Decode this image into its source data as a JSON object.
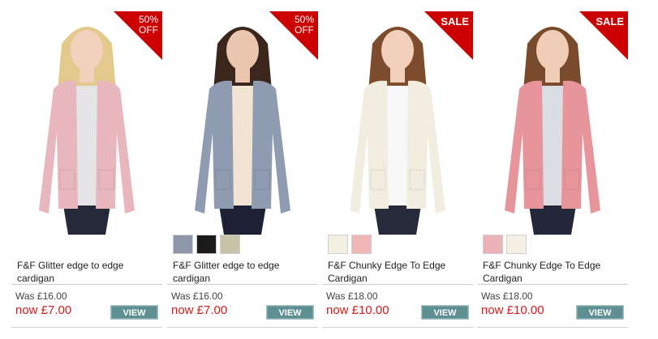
{
  "products": [
    {
      "badge": "50%\nOFF",
      "badge_type": "discount",
      "title_line1": "F&F Glitter edge to edge",
      "title_line2": "cardigan",
      "was": "Was £16.00",
      "now": "now £7.00",
      "view_label": "VIEW",
      "swatches": [],
      "colors": {
        "cardigan": "#e8b6bd",
        "top": "#e5e5e8",
        "jeans": "#26293a",
        "hair": "#e3c98b",
        "skin": "#f2d2bd"
      }
    },
    {
      "badge": "50%\nOFF",
      "badge_type": "discount",
      "title_line1": "F&F Glitter edge to edge",
      "title_line2": "cardigan",
      "was": "Was £16.00",
      "now": "now £7.00",
      "view_label": "VIEW",
      "swatches": [
        "#8d97a8",
        "#1c1b1b",
        "#c7c2a8"
      ],
      "colors": {
        "cardigan": "#8e9bb0",
        "top": "#f1e4d2",
        "jeans": "#1d2133",
        "hair": "#3a261c",
        "skin": "#eac6ae"
      }
    },
    {
      "badge": "SALE",
      "badge_type": "sale",
      "title_line1": "F&F Chunky Edge To Edge",
      "title_line2": "Cardigan",
      "was": "Was £18.00",
      "now": "now £10.00",
      "view_label": "VIEW",
      "swatches": [
        "#f3efe1",
        "#f0b7b9"
      ],
      "colors": {
        "cardigan": "#f1ede0",
        "top": "#f8f8f8",
        "jeans": "#262a3b",
        "hair": "#7c4c2c",
        "skin": "#f2cfba"
      }
    },
    {
      "badge": "SALE",
      "badge_type": "sale",
      "title_line1": "F&F Chunky Edge To Edge",
      "title_line2": "Cardigan",
      "was": "Was £18.00",
      "now": "now £10.00",
      "view_label": "VIEW",
      "swatches": [
        "#eab3b7",
        "#f4f0e3"
      ],
      "colors": {
        "cardigan": "#e8949b",
        "top": "#dcdde2",
        "jeans": "#22273a",
        "hair": "#7a4a2c",
        "skin": "#f1cdb7"
      }
    }
  ]
}
